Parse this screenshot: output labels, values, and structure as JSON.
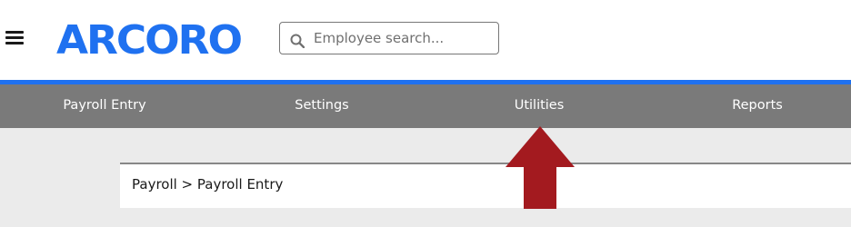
{
  "header": {
    "menu_icon": "hamburger-menu-icon",
    "logo_text": "ARCORO",
    "brand_color": "#1f71f0",
    "search": {
      "placeholder": "Employee search...",
      "value": "",
      "icon": "search-icon"
    }
  },
  "nav": {
    "items": [
      {
        "label": "Payroll Entry"
      },
      {
        "label": "Settings"
      },
      {
        "label": "Utilities"
      },
      {
        "label": "Reports"
      }
    ]
  },
  "breadcrumb": {
    "text": "Payroll > Payroll Entry"
  },
  "annotation": {
    "icon": "up-arrow-annotation-icon",
    "color": "#a31a1f"
  }
}
